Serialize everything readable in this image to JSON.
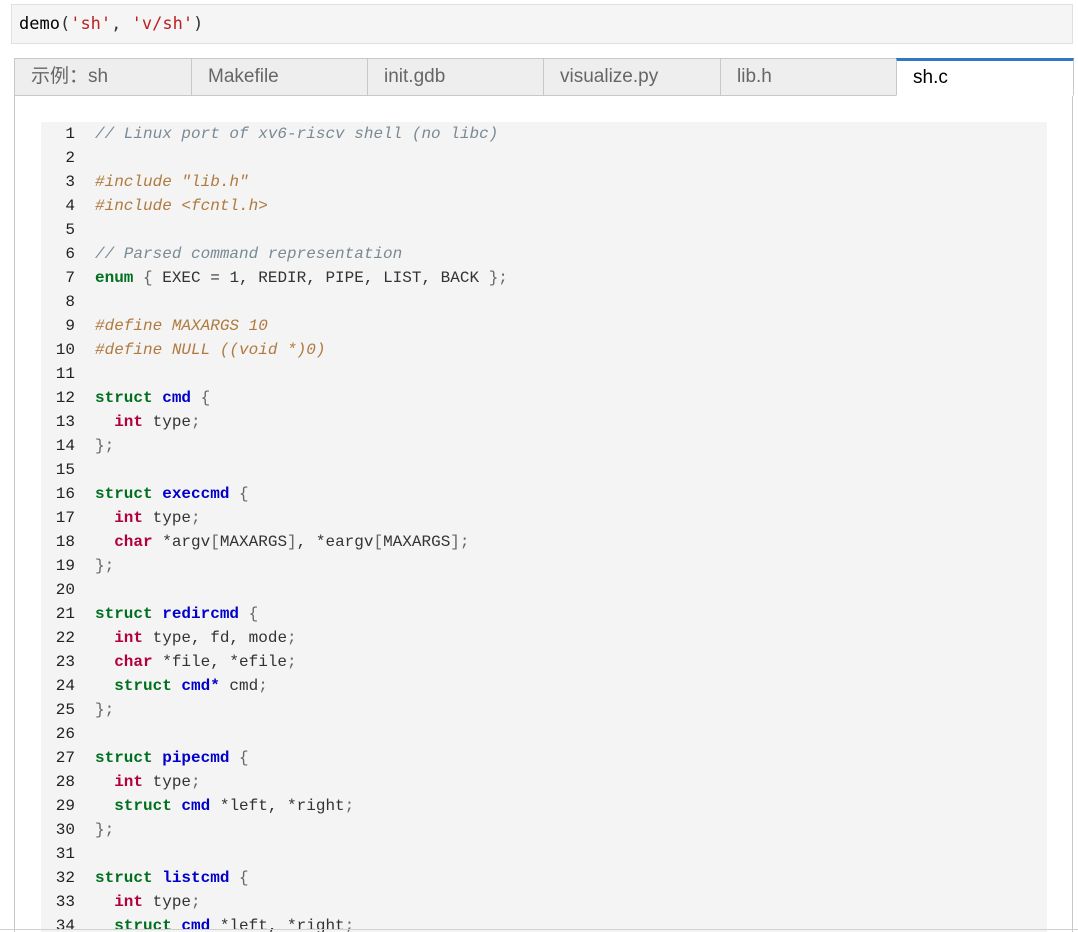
{
  "cell": {
    "fn": "demo",
    "open": "(",
    "arg1": "'sh'",
    "sep": ", ",
    "arg2": "'v/sh'",
    "close": ")"
  },
  "tabs": [
    {
      "label": "示例：sh",
      "active": false
    },
    {
      "label": "Makefile",
      "active": false
    },
    {
      "label": "init.gdb",
      "active": false
    },
    {
      "label": "visualize.py",
      "active": false
    },
    {
      "label": "lib.h",
      "active": false
    },
    {
      "label": "sh.c",
      "active": true
    }
  ],
  "code": {
    "lines": [
      {
        "n": "1",
        "tokens": [
          {
            "t": "// Linux port of xv6-riscv shell (no libc)",
            "c": "comment"
          }
        ]
      },
      {
        "n": "2",
        "tokens": []
      },
      {
        "n": "3",
        "tokens": [
          {
            "t": "#include \"lib.h\"",
            "c": "pre"
          }
        ]
      },
      {
        "n": "4",
        "tokens": [
          {
            "t": "#include <fcntl.h>",
            "c": "pre"
          }
        ]
      },
      {
        "n": "5",
        "tokens": []
      },
      {
        "n": "6",
        "tokens": [
          {
            "t": "// Parsed command representation",
            "c": "comment"
          }
        ]
      },
      {
        "n": "7",
        "tokens": [
          {
            "t": "enum",
            "c": "kw"
          },
          {
            "t": " ",
            "c": "plain"
          },
          {
            "t": "{",
            "c": "punc"
          },
          {
            "t": " EXEC = 1, REDIR, PIPE, LIST, BACK ",
            "c": "plain"
          },
          {
            "t": "};",
            "c": "punc"
          }
        ]
      },
      {
        "n": "8",
        "tokens": []
      },
      {
        "n": "9",
        "tokens": [
          {
            "t": "#define MAXARGS 10",
            "c": "pre"
          }
        ]
      },
      {
        "n": "10",
        "tokens": [
          {
            "t": "#define NULL ((void *)0)",
            "c": "pre"
          }
        ]
      },
      {
        "n": "11",
        "tokens": []
      },
      {
        "n": "12",
        "tokens": [
          {
            "t": "struct",
            "c": "kw"
          },
          {
            "t": " ",
            "c": "plain"
          },
          {
            "t": "cmd",
            "c": "name"
          },
          {
            "t": " {",
            "c": "punc"
          }
        ]
      },
      {
        "n": "13",
        "tokens": [
          {
            "t": "  ",
            "c": "plain"
          },
          {
            "t": "int",
            "c": "type"
          },
          {
            "t": " type",
            "c": "plain"
          },
          {
            "t": ";",
            "c": "punc"
          }
        ]
      },
      {
        "n": "14",
        "tokens": [
          {
            "t": "};",
            "c": "punc"
          }
        ]
      },
      {
        "n": "15",
        "tokens": []
      },
      {
        "n": "16",
        "tokens": [
          {
            "t": "struct",
            "c": "kw"
          },
          {
            "t": " ",
            "c": "plain"
          },
          {
            "t": "execcmd",
            "c": "name"
          },
          {
            "t": " {",
            "c": "punc"
          }
        ]
      },
      {
        "n": "17",
        "tokens": [
          {
            "t": "  ",
            "c": "plain"
          },
          {
            "t": "int",
            "c": "type"
          },
          {
            "t": " type",
            "c": "plain"
          },
          {
            "t": ";",
            "c": "punc"
          }
        ]
      },
      {
        "n": "18",
        "tokens": [
          {
            "t": "  ",
            "c": "plain"
          },
          {
            "t": "char",
            "c": "type"
          },
          {
            "t": " *argv",
            "c": "plain"
          },
          {
            "t": "[",
            "c": "punc"
          },
          {
            "t": "MAXARGS",
            "c": "plain"
          },
          {
            "t": "]",
            "c": "punc"
          },
          {
            "t": ", *eargv",
            "c": "plain"
          },
          {
            "t": "[",
            "c": "punc"
          },
          {
            "t": "MAXARGS",
            "c": "plain"
          },
          {
            "t": "];",
            "c": "punc"
          }
        ]
      },
      {
        "n": "19",
        "tokens": [
          {
            "t": "};",
            "c": "punc"
          }
        ]
      },
      {
        "n": "20",
        "tokens": []
      },
      {
        "n": "21",
        "tokens": [
          {
            "t": "struct",
            "c": "kw"
          },
          {
            "t": " ",
            "c": "plain"
          },
          {
            "t": "redircmd",
            "c": "name"
          },
          {
            "t": " {",
            "c": "punc"
          }
        ]
      },
      {
        "n": "22",
        "tokens": [
          {
            "t": "  ",
            "c": "plain"
          },
          {
            "t": "int",
            "c": "type"
          },
          {
            "t": " type, fd, mode",
            "c": "plain"
          },
          {
            "t": ";",
            "c": "punc"
          }
        ]
      },
      {
        "n": "23",
        "tokens": [
          {
            "t": "  ",
            "c": "plain"
          },
          {
            "t": "char",
            "c": "type"
          },
          {
            "t": " *file, *efile",
            "c": "plain"
          },
          {
            "t": ";",
            "c": "punc"
          }
        ]
      },
      {
        "n": "24",
        "tokens": [
          {
            "t": "  ",
            "c": "plain"
          },
          {
            "t": "struct",
            "c": "kw"
          },
          {
            "t": " ",
            "c": "plain"
          },
          {
            "t": "cmd*",
            "c": "name"
          },
          {
            "t": " cmd",
            "c": "plain"
          },
          {
            "t": ";",
            "c": "punc"
          }
        ]
      },
      {
        "n": "25",
        "tokens": [
          {
            "t": "};",
            "c": "punc"
          }
        ]
      },
      {
        "n": "26",
        "tokens": []
      },
      {
        "n": "27",
        "tokens": [
          {
            "t": "struct",
            "c": "kw"
          },
          {
            "t": " ",
            "c": "plain"
          },
          {
            "t": "pipecmd",
            "c": "name"
          },
          {
            "t": " {",
            "c": "punc"
          }
        ]
      },
      {
        "n": "28",
        "tokens": [
          {
            "t": "  ",
            "c": "plain"
          },
          {
            "t": "int",
            "c": "type"
          },
          {
            "t": " type",
            "c": "plain"
          },
          {
            "t": ";",
            "c": "punc"
          }
        ]
      },
      {
        "n": "29",
        "tokens": [
          {
            "t": "  ",
            "c": "plain"
          },
          {
            "t": "struct",
            "c": "kw"
          },
          {
            "t": " ",
            "c": "plain"
          },
          {
            "t": "cmd",
            "c": "name"
          },
          {
            "t": " *left, *right",
            "c": "plain"
          },
          {
            "t": ";",
            "c": "punc"
          }
        ]
      },
      {
        "n": "30",
        "tokens": [
          {
            "t": "};",
            "c": "punc"
          }
        ]
      },
      {
        "n": "31",
        "tokens": []
      },
      {
        "n": "32",
        "tokens": [
          {
            "t": "struct",
            "c": "kw"
          },
          {
            "t": " ",
            "c": "plain"
          },
          {
            "t": "listcmd",
            "c": "name"
          },
          {
            "t": " {",
            "c": "punc"
          }
        ]
      },
      {
        "n": "33",
        "tokens": [
          {
            "t": "  ",
            "c": "plain"
          },
          {
            "t": "int",
            "c": "type"
          },
          {
            "t": " type",
            "c": "plain"
          },
          {
            "t": ";",
            "c": "punc"
          }
        ]
      },
      {
        "n": "34",
        "tokens": [
          {
            "t": "  ",
            "c": "plain"
          },
          {
            "t": "struct",
            "c": "kw"
          },
          {
            "t": " ",
            "c": "plain"
          },
          {
            "t": "cmd",
            "c": "name"
          },
          {
            "t": " *left, *right",
            "c": "plain"
          },
          {
            "t": ";",
            "c": "punc"
          }
        ]
      }
    ]
  }
}
